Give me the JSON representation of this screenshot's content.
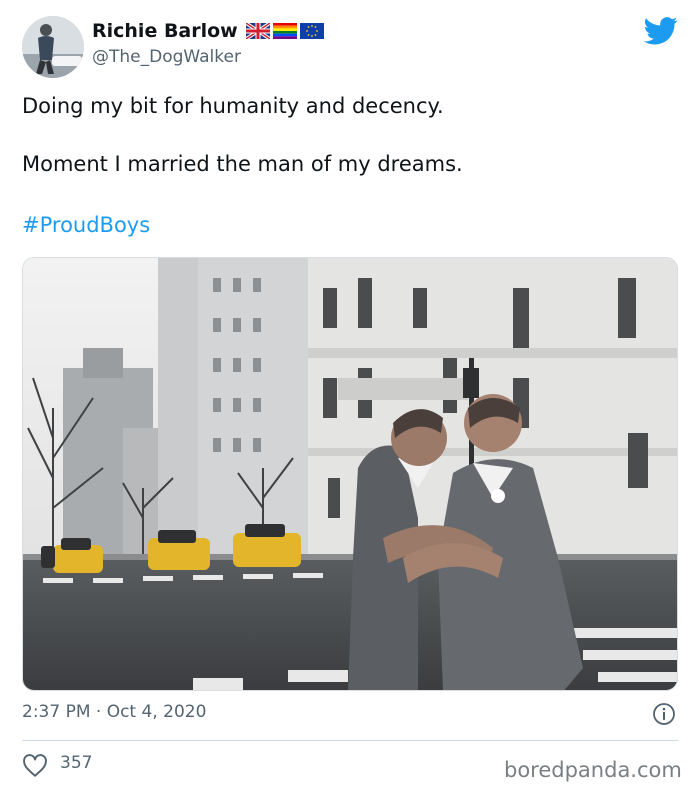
{
  "user": {
    "display_name": "Richie Barlow",
    "handle": "@The_DogWalker",
    "flags": [
      "uk-flag",
      "rainbow-flag",
      "eu-flag"
    ]
  },
  "tweet": {
    "line1": "Doing my bit for humanity and decency.",
    "line2": "Moment I married the man of my dreams.",
    "hashtag": "#ProudBoys",
    "timestamp": "2:37 PM · Oct 4, 2020",
    "likes": "357"
  },
  "watermark": "boredpanda.com",
  "colors": {
    "link": "#1d9bf0",
    "secondary_text": "#536471",
    "twitter_blue": "#1d9bf0"
  },
  "icons": [
    "twitter-bird-icon",
    "info-icon",
    "heart-icon"
  ]
}
